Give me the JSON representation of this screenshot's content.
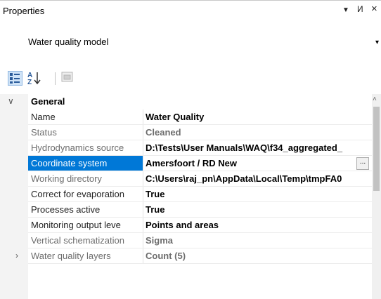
{
  "panel": {
    "title": "Properties",
    "pin_glyph": "И",
    "dropdown_glyph": "▼",
    "close_glyph": "×"
  },
  "selector": {
    "value": "Water quality model",
    "arrow_glyph": "▾"
  },
  "category": {
    "name": "General",
    "chevron": "∨"
  },
  "properties": [
    {
      "name": "Name",
      "value": "Water Quality"
    },
    {
      "name": "Status",
      "value": "Cleaned"
    },
    {
      "name": "Hydrodynamics source",
      "value": "D:\\Tests\\User Manuals\\WAQ\\f34_aggregated_"
    },
    {
      "name": "Coordinate system",
      "value": "Amersfoort / RD New",
      "button": "..."
    },
    {
      "name": "Working directory",
      "value": "C:\\Users\\raj_pn\\AppData\\Local\\Temp\\tmpFA0"
    },
    {
      "name": "Correct for evaporation",
      "value": "True"
    },
    {
      "name": "Processes active",
      "value": "True"
    },
    {
      "name": "Monitoring output leve",
      "value": "Points and areas"
    },
    {
      "name": "Vertical schematization",
      "value": "Sigma"
    },
    {
      "name": "Water quality layers",
      "value": "Count (5)",
      "chevron": "›"
    }
  ],
  "scrollbar": {
    "up_glyph": "˄"
  },
  "colors": {
    "selection": "#0078d7",
    "dim_text": "#6d6d6d"
  }
}
